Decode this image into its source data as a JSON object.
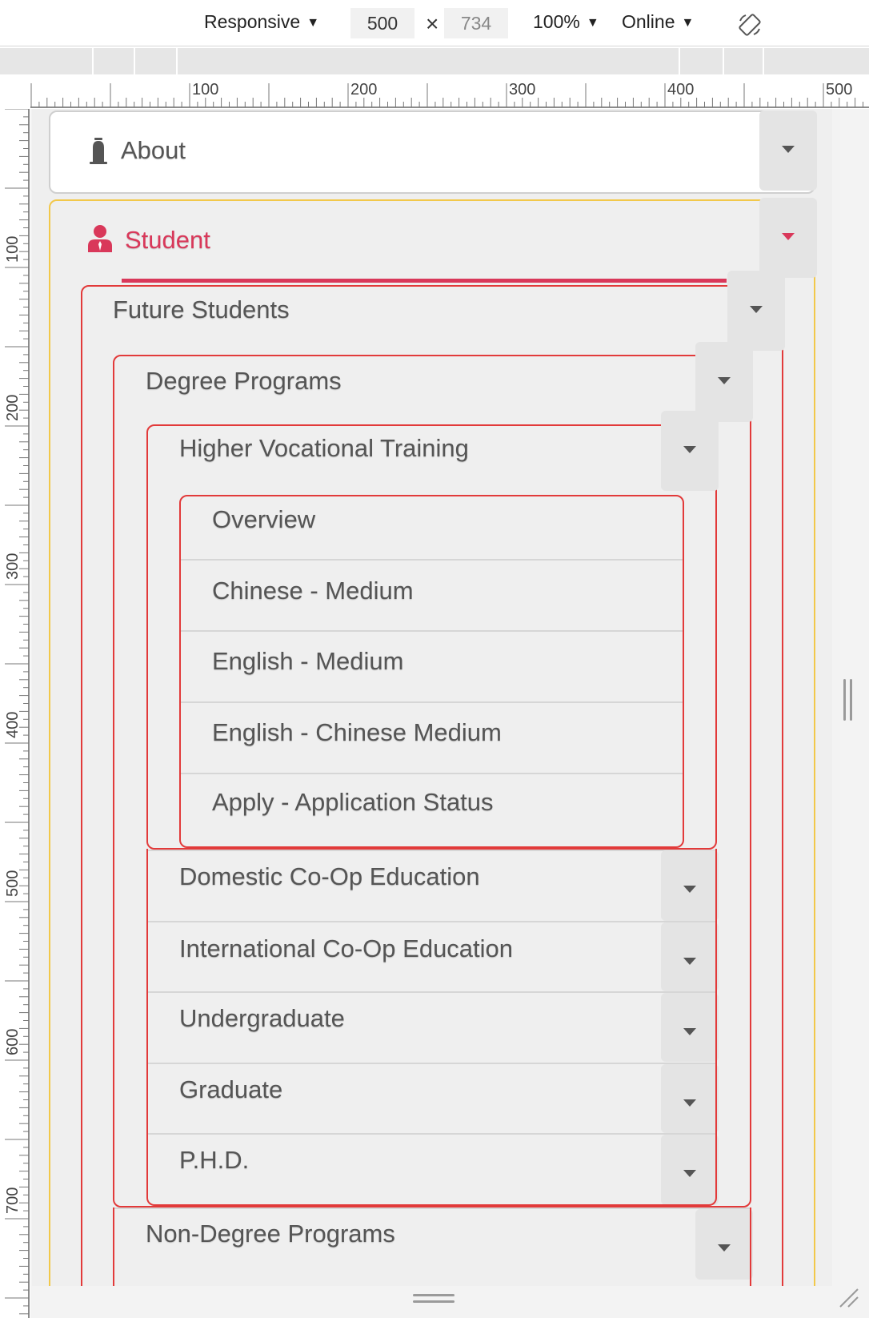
{
  "toolbar": {
    "device": "Responsive",
    "width": "500",
    "times": "×",
    "height": "734",
    "zoom": "100%",
    "network": "Online"
  },
  "ruler": {
    "top_labels": [
      "100",
      "200",
      "300",
      "400",
      "500"
    ],
    "left_labels": [
      "100",
      "200",
      "300",
      "400",
      "500",
      "600",
      "700"
    ]
  },
  "menu": {
    "about": "About",
    "student": "Student",
    "future_students": "Future Students",
    "degree_programs": "Degree Programs",
    "higher_vocational_training": "Higher Vocational Training",
    "hvt_items": [
      "Overview",
      "Chinese - Medium",
      "English - Medium",
      "English - Chinese Medium",
      "Apply - Application Status"
    ],
    "degree_items": [
      "Domestic Co-Op Education",
      "International Co-Op Education",
      "Undergraduate",
      "Graduate",
      "P.H.D."
    ],
    "non_degree_programs": "Non-Degree Programs"
  },
  "colors": {
    "accent": "#d9385a",
    "outline_gold": "#f2c84a",
    "outline_red": "#e23a3a"
  }
}
